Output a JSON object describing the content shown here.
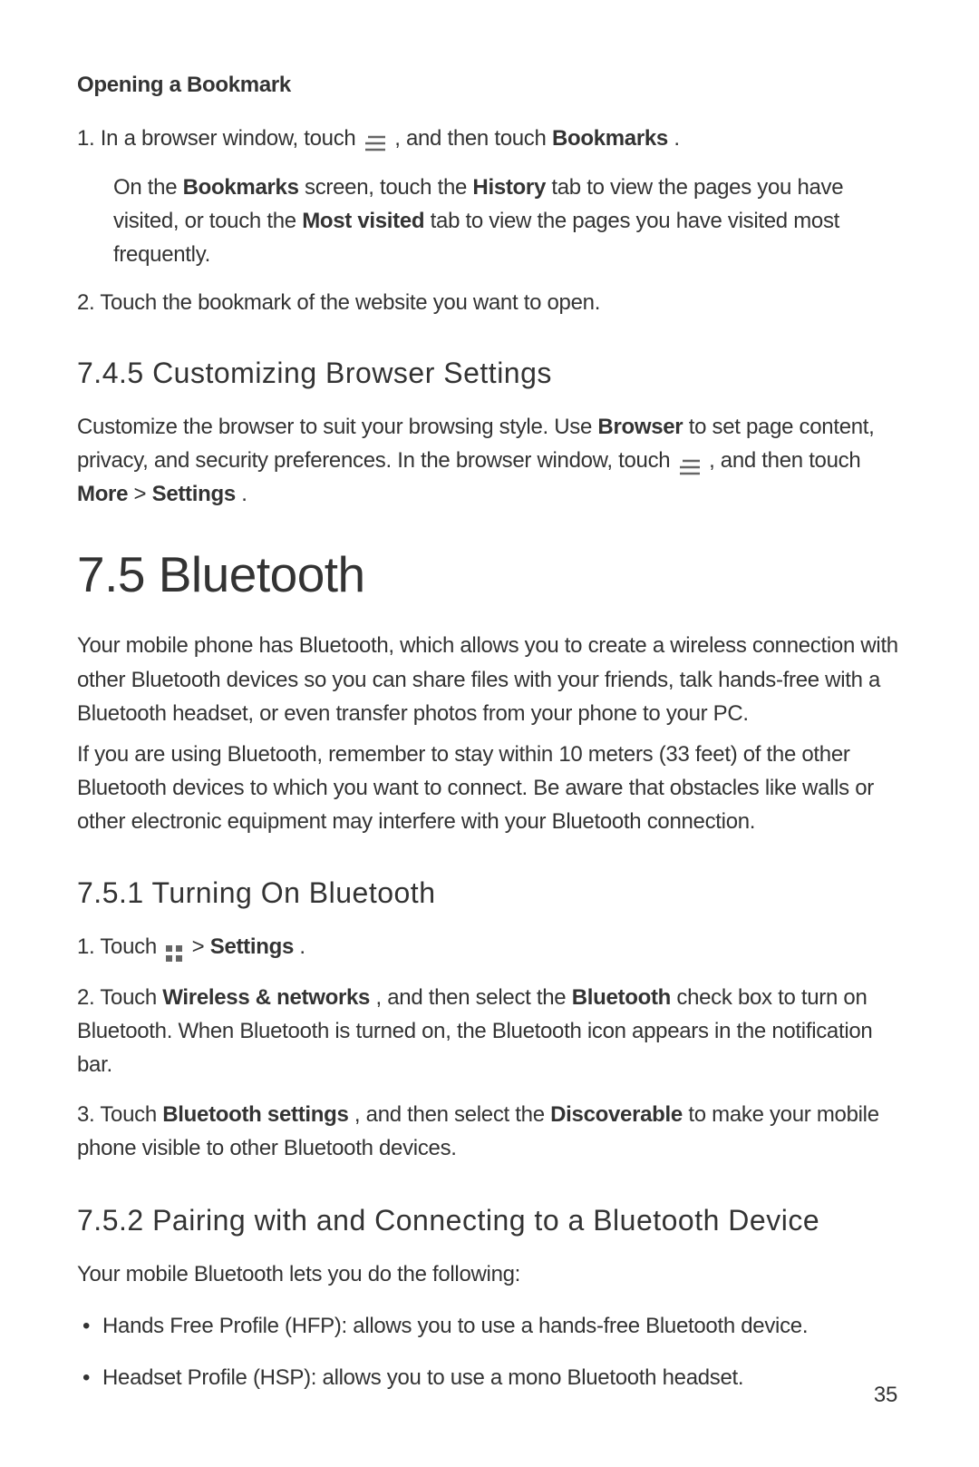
{
  "opening_bookmark": {
    "title": "Opening a Bookmark",
    "step1_prefix": "1. In a browser window, touch ",
    "step1_mid": " , and then touch ",
    "step1_bold": "Bookmarks",
    "step1_end": ".",
    "indent_prefix": "On the ",
    "indent_bold1": "Bookmarks",
    "indent_mid1": " screen, touch the ",
    "indent_bold2": "History",
    "indent_mid2": " tab to view the pages you have visited, or touch the ",
    "indent_bold3": "Most visited",
    "indent_end": " tab to view the pages you have visited most frequently.",
    "step2": "2. Touch the bookmark of the website you want to open."
  },
  "customizing": {
    "title": "7.4.5  Customizing Browser Settings",
    "para_prefix": "Customize the browser to suit your browsing style. Use ",
    "para_bold1": "Browser",
    "para_mid1": " to set page content, privacy, and security preferences. In the browser window, touch ",
    "para_mid2": " , and then touch ",
    "para_bold2": "More",
    "para_gt": " > ",
    "para_bold3": "Settings",
    "para_end": "."
  },
  "bluetooth": {
    "title": "7.5  Bluetooth",
    "para1": "Your mobile phone has Bluetooth, which allows you to create a wireless connection with other Bluetooth devices so you can share files with your friends, talk hands-free with a Bluetooth headset, or even transfer photos from your phone to your PC.",
    "para2": "If you are using Bluetooth, remember to stay within 10 meters (33 feet) of the other Bluetooth devices to which you want to connect. Be aware that obstacles like walls or other electronic equipment may interfere with your Bluetooth connection."
  },
  "turning_on": {
    "title": "7.5.1  Turning On Bluetooth",
    "step1_prefix": "1. Touch ",
    "step1_mid": "  > ",
    "step1_bold": "Settings",
    "step1_end": ".",
    "step2_prefix": "2. Touch ",
    "step2_bold1": "Wireless & networks",
    "step2_mid1": ", and then select the ",
    "step2_bold2": "Bluetooth",
    "step2_end": " check box to turn on Bluetooth. When Bluetooth is turned on, the Bluetooth icon appears in the notification bar.",
    "step3_prefix": "3. Touch ",
    "step3_bold1": "Bluetooth settings",
    "step3_mid1": ", and then select the ",
    "step3_bold2": "Discoverable",
    "step3_end": " to make your mobile phone visible to other Bluetooth devices."
  },
  "pairing": {
    "title": "7.5.2  Pairing with and Connecting to a Bluetooth Device",
    "intro": "Your mobile Bluetooth lets you do the following:",
    "bullet1": "Hands Free Profile (HFP): allows you to use a hands-free Bluetooth device.",
    "bullet2": "Headset Profile (HSP): allows you to use a mono Bluetooth headset."
  },
  "page_number": "35"
}
